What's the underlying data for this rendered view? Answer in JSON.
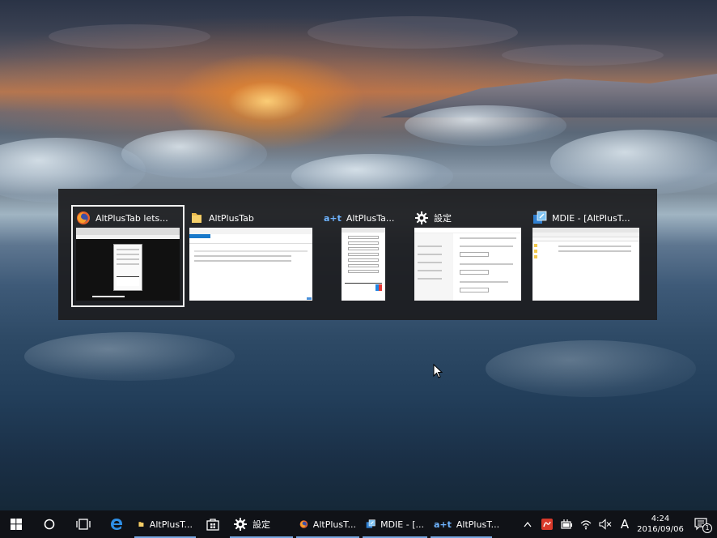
{
  "switcher": {
    "windows": [
      {
        "title": "AltPlusTab lets...",
        "icon": "firefox-icon",
        "selected": true
      },
      {
        "title": "AltPlusTab",
        "icon": "folder-icon",
        "selected": false
      },
      {
        "title": "AltPlusTa...",
        "icon": "altplustab-icon",
        "selected": false
      },
      {
        "title": "設定",
        "icon": "gear-icon",
        "selected": false
      },
      {
        "title": "MDIE - [AltPlusT...",
        "icon": "mdie-icon",
        "selected": false
      }
    ]
  },
  "taskbar": {
    "apps": [
      {
        "label": "AltPlusT...",
        "icon": "folder-icon"
      },
      {
        "label": "",
        "icon": "store-icon"
      },
      {
        "label": "設定",
        "icon": "gear-icon"
      },
      {
        "label": "AltPlusT...",
        "icon": "firefox-icon"
      },
      {
        "label": "MDIE - [...",
        "icon": "mdie-icon"
      },
      {
        "label": "AltPlusT...",
        "icon": "altplustab-icon"
      }
    ],
    "ime_label": "A",
    "clock_time": "4:24",
    "clock_date": "2016/09/06",
    "notification_count": "1"
  },
  "colors": {
    "accent": "#76a6e0",
    "taskbar_bg": "#101217",
    "switcher_bg": "#1c1c1e"
  }
}
